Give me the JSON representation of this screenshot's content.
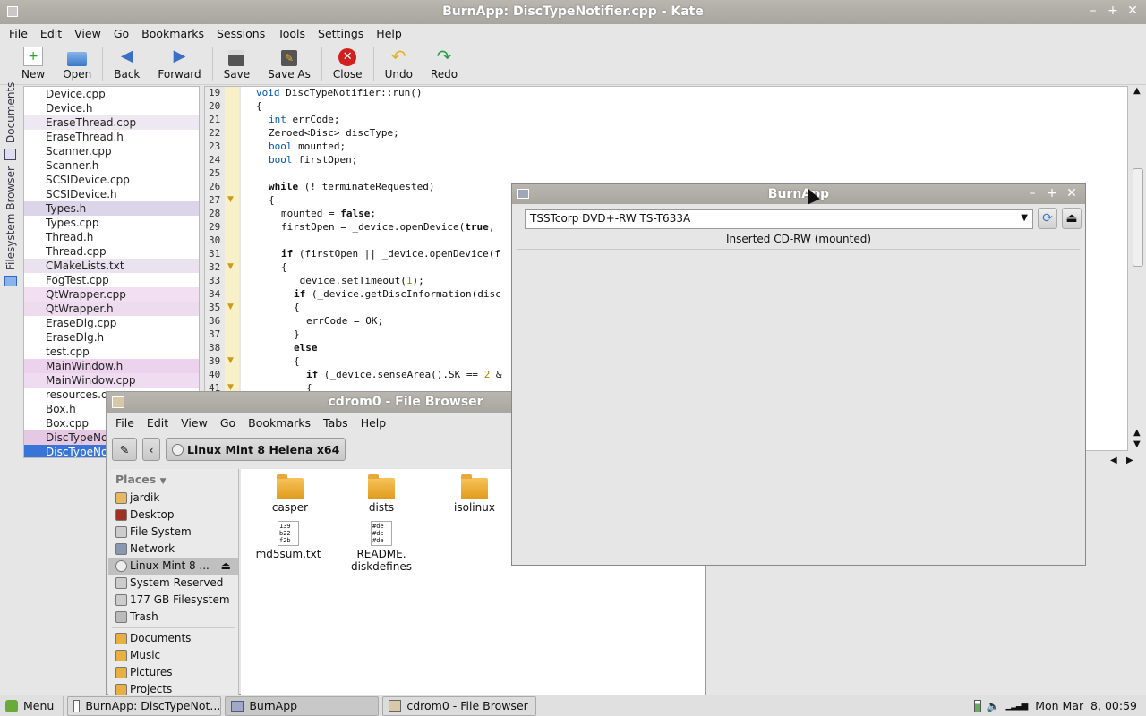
{
  "kate": {
    "title": "BurnApp: DiscTypeNotifier.cpp - Kate",
    "menu": [
      "File",
      "Edit",
      "View",
      "Go",
      "Bookmarks",
      "Sessions",
      "Tools",
      "Settings",
      "Help"
    ],
    "toolbar": {
      "new": "New",
      "open": "Open",
      "back": "Back",
      "forward": "Forward",
      "save": "Save",
      "save_as": "Save As",
      "close": "Close",
      "undo": "Undo",
      "redo": "Redo"
    },
    "tabs": {
      "documents": "Documents",
      "filesystem": "Filesystem Browser"
    },
    "documents": [
      "Device.cpp",
      "Device.h",
      "EraseThread.cpp",
      "EraseThread.h",
      "Scanner.cpp",
      "Scanner.h",
      "SCSIDevice.cpp",
      "SCSIDevice.h",
      "Types.h",
      "Types.cpp",
      "Thread.h",
      "Thread.cpp",
      "CMakeLists.txt",
      "FogTest.cpp",
      "QtWrapper.cpp",
      "QtWrapper.h",
      "EraseDlg.cpp",
      "EraseDlg.h",
      "test.cpp",
      "MainWindow.h",
      "MainWindow.cpp",
      "resources.q",
      "Box.h",
      "Box.cpp",
      "DiscTypeNot",
      "DiscTypeNot"
    ],
    "line_numbers": [
      "19",
      "20",
      "21",
      "22",
      "23",
      "24",
      "25",
      "26",
      "27",
      "28",
      "29",
      "30",
      "31",
      "32",
      "33",
      "34",
      "35",
      "36",
      "37",
      "38",
      "39",
      "40",
      "41"
    ]
  },
  "code": {
    "l19_a": "void ",
    "l19_b": "DiscTypeNotifier::run()",
    "l20": "{",
    "l21_t": "int",
    "l21_r": " errCode;",
    "l22": "Zeroed<Disc> discType;",
    "l23_t": "bool",
    "l23_r": " mounted;",
    "l24_t": "bool",
    "l24_r": " firstOpen;",
    "l26_k": "while",
    "l26_r": " (!_terminateRequested)",
    "l27": "{",
    "l28_a": "mounted = ",
    "l28_k": "false",
    "l28_r": ";",
    "l29_a": "firstOpen = _device.openDevice(",
    "l29_k": "true",
    "l29_r": ",",
    "l31_k": "if",
    "l31_r": " (firstOpen || _device.openDevice(f",
    "l32": "{",
    "l33_a": "_device.setTimeout(",
    "l33_n": "1",
    "l33_r": ");",
    "l34_k": "if",
    "l34_r": " (_device.getDiscInformation(disc",
    "l35": "{",
    "l36": "errCode = OK;",
    "l37": "}",
    "l38_k": "else",
    "l39": "{",
    "l40_k": "if",
    "l40_a": " (_device.senseArea().SK == ",
    "l40_n": "2",
    "l40_r": " &",
    "l41": "{"
  },
  "file_browser": {
    "title": "cdrom0 - File Browser",
    "menu": [
      "File",
      "Edit",
      "View",
      "Go",
      "Bookmarks",
      "Tabs",
      "Help"
    ],
    "path_button": "Linux Mint 8 Helena x64",
    "places_header": "Places",
    "places": [
      "jardik",
      "Desktop",
      "File System",
      "Network",
      "Linux Mint 8 ...",
      "System Reserved",
      "177 GB Filesystem",
      "Trash",
      "Documents",
      "Music",
      "Pictures",
      "Projects"
    ],
    "files": [
      "casper",
      "dists",
      "isolinux",
      "md5sum.txt",
      "README.",
      "diskdefines"
    ],
    "md5_preview": "139\nb22\nf2b",
    "readme_preview": "#de\n#de\n#de"
  },
  "burnapp": {
    "title": "BurnApp",
    "device": "TSSTcorp DVD+-RW TS-T633A",
    "status": "Inserted CD-RW (mounted)"
  },
  "taskbar": {
    "menu": "Menu",
    "windows": [
      "BurnApp: DiscTypeNot...",
      "BurnApp",
      "cdrom0 - File Browser"
    ],
    "clock": "Mon Mar  8, 00:59"
  }
}
